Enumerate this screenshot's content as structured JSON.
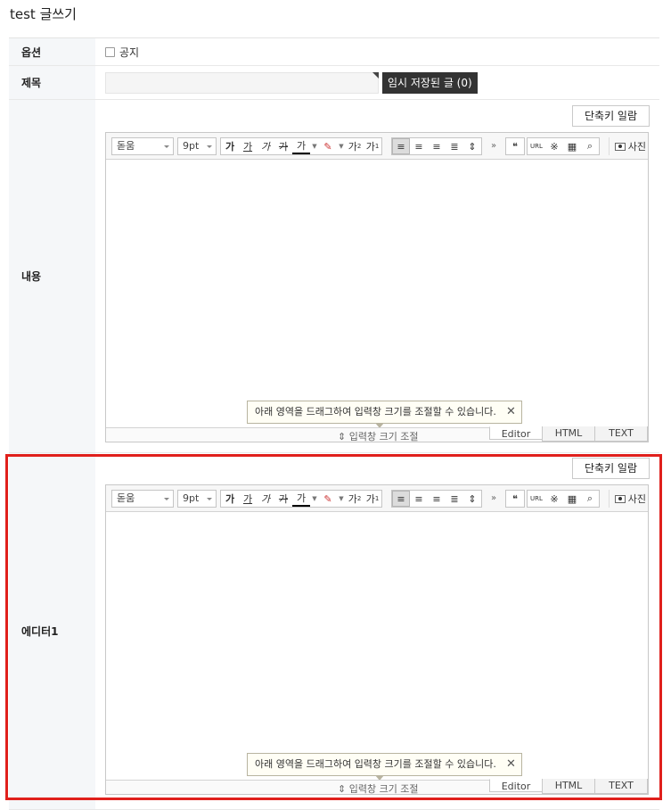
{
  "page": {
    "title": "test 글쓰기"
  },
  "rows": {
    "option": {
      "label": "옵션",
      "checkbox_label": "공지",
      "checked": false
    },
    "title": {
      "label": "제목",
      "value": "",
      "temp_saved": "임시 저장된 글 (0)"
    },
    "content": {
      "label": "내용"
    },
    "editor1": {
      "label": "에디터1"
    }
  },
  "editor": {
    "shortcut_button": "단축키 일람",
    "font_select": "돋움",
    "size_select": "9pt",
    "buttons": {
      "bold": "가",
      "underline": "가",
      "italic": "가",
      "strike": "가",
      "font_color": "가",
      "superscript": "가",
      "subscript": "가",
      "more": "»",
      "quote": "❝",
      "url": "URL",
      "special_char": "※",
      "table": "▦",
      "find": "⌕",
      "photo": "사진"
    },
    "resize_label": "⇕ 입력창 크기 조절",
    "tooltip": "아래 영역을 드래그하여 입력창 크기를 조절할 수 있습니다.",
    "tooltip_close": "✕",
    "modes": [
      "Editor",
      "HTML",
      "TEXT"
    ]
  },
  "colors": {
    "highlight": "#e0201c",
    "header_bg": "#f5f7f9",
    "temp_saved_bg": "#333333"
  }
}
